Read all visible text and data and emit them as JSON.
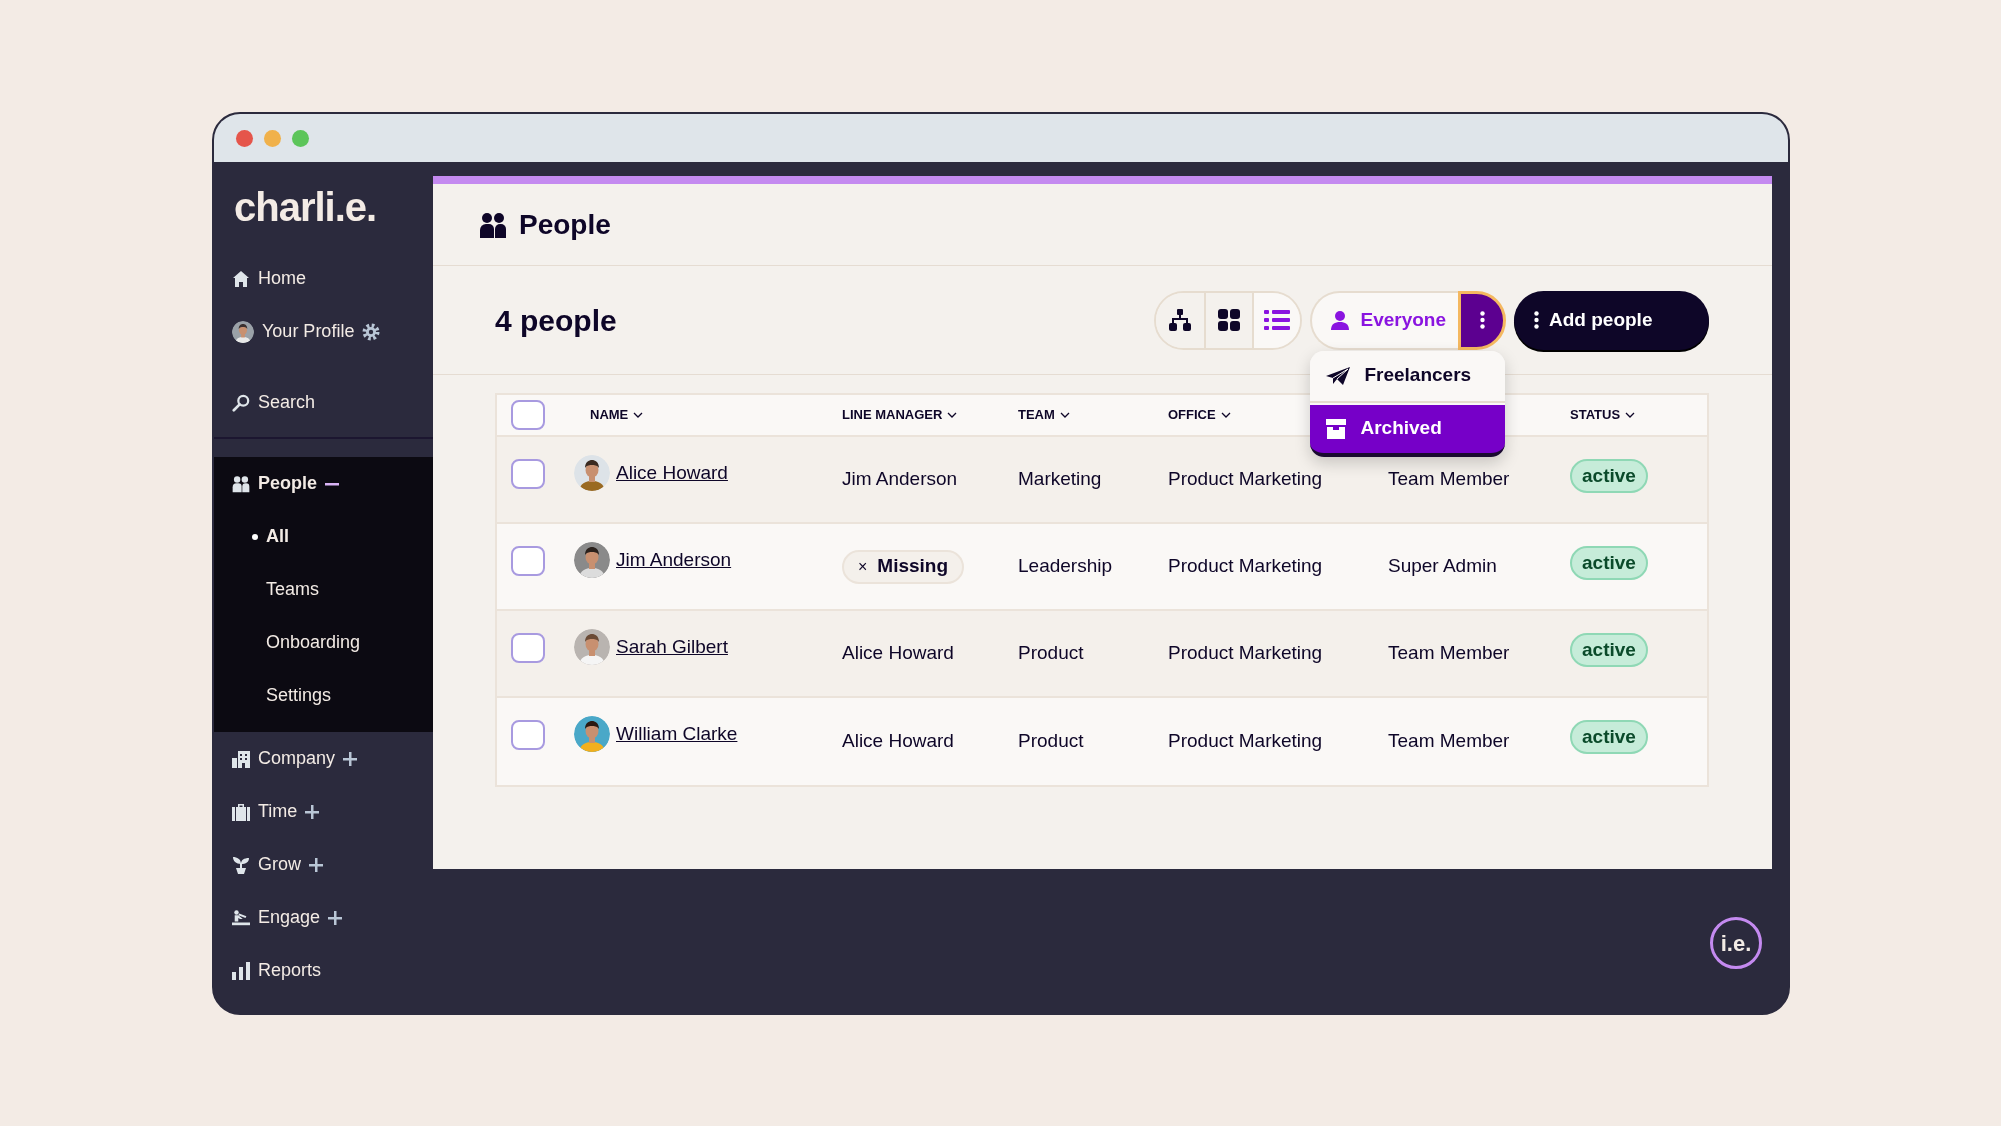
{
  "brand": {
    "logo": "charli.e.",
    "corner_logo": "i.e."
  },
  "sidebar": {
    "items": [
      {
        "label": "Home",
        "kind": "link"
      },
      {
        "label": "Your Profile",
        "kind": "profile"
      },
      {
        "label": "Search",
        "kind": "link"
      },
      {
        "label": "People",
        "kind": "section",
        "expanded": true,
        "children": [
          {
            "label": "All",
            "selected": true
          },
          {
            "label": "Teams",
            "selected": false
          },
          {
            "label": "Onboarding",
            "selected": false
          },
          {
            "label": "Settings",
            "selected": false
          }
        ]
      },
      {
        "label": "Company",
        "kind": "section",
        "expanded": false
      },
      {
        "label": "Time",
        "kind": "section",
        "expanded": false
      },
      {
        "label": "Grow",
        "kind": "section",
        "expanded": false
      },
      {
        "label": "Engage",
        "kind": "section",
        "expanded": false
      },
      {
        "label": "Reports",
        "kind": "link"
      }
    ]
  },
  "page": {
    "title": "People",
    "count": "4 people"
  },
  "toolbar": {
    "views": [
      {
        "selected": false
      },
      {
        "selected": false
      },
      {
        "selected": true
      }
    ],
    "filter": {
      "label": "Everyone",
      "menu_open": true
    },
    "menu": [
      {
        "label": "Freelancers",
        "selected": false
      },
      {
        "label": "Archived",
        "selected": true
      }
    ],
    "add_button": "Add people"
  },
  "table": {
    "select_all": {
      "checked": false
    },
    "columns": [
      "NAME",
      "LINE MANAGER",
      "TEAM",
      "OFFICE",
      "STATUS"
    ],
    "rows": [
      {
        "checked": false,
        "name": "Alice Howard",
        "line_manager": {
          "kind": "text",
          "text": "Jim Anderson"
        },
        "team": "Marketing",
        "office": "Product Marketing",
        "column_5": "Team Member",
        "status": "active"
      },
      {
        "checked": false,
        "name": "Jim Anderson",
        "line_manager": {
          "kind": "missing",
          "text": "Missing",
          "icon": "×"
        },
        "team": "Leadership",
        "office": "Product Marketing",
        "column_5": "Super Admin",
        "status": "active"
      },
      {
        "checked": false,
        "name": "Sarah Gilbert",
        "line_manager": {
          "kind": "text",
          "text": "Alice Howard"
        },
        "team": "Product",
        "office": "Product Marketing",
        "column_5": "Team Member",
        "status": "active"
      },
      {
        "checked": false,
        "name": "William Clarke",
        "line_manager": {
          "kind": "text",
          "text": "Alice Howard"
        },
        "team": "Product",
        "office": "Product Marketing",
        "column_5": "Team Member",
        "status": "active"
      }
    ]
  }
}
